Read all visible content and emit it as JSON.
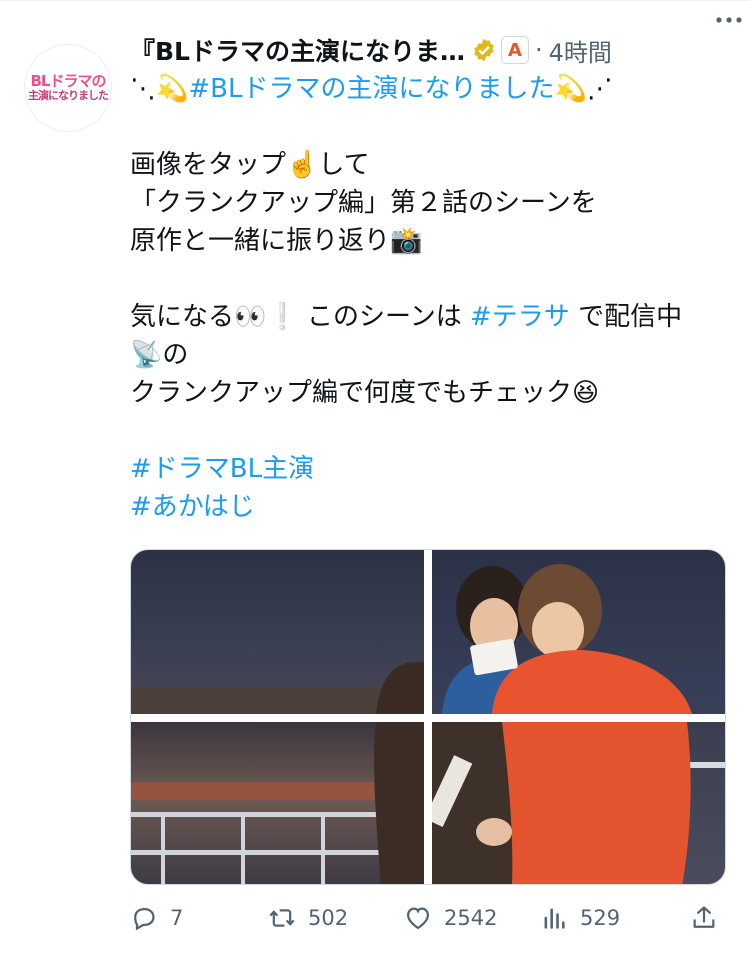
{
  "tweet": {
    "display_name": "『BLドラマの主演になりま…",
    "affiliate_badge": "A",
    "separator": "·",
    "timestamp": "4時間",
    "avatar_text_line1": "BLドラマの",
    "avatar_text_line2": "主演になりました",
    "lines": [
      {
        "pre": "⋱",
        "emoji1": "💫",
        "hashtag": "#BLドラマの主演になりました",
        "emoji2": "💫",
        "post": "⋰"
      },
      {
        "text": "画像をタップ",
        "emoji": "☝️",
        "after": "して"
      },
      {
        "text": "「クランクアップ編」第２話のシーンを"
      },
      {
        "text": "原作と一緒に振り返り",
        "emoji": "📸"
      },
      {
        "text": "気になる",
        "emoji1": "👀",
        "emoji2": "❕",
        "mid": "このシーンは",
        "hashtag": "#テラサ",
        "after": "で配信中"
      },
      {
        "emoji": "📡",
        "after": "の"
      },
      {
        "text": "クランクアップ編で何度でもチェック",
        "emoji": "😆"
      },
      {
        "hashtag": "#ドラマBL主演"
      },
      {
        "hashtag": "#あかはじ"
      }
    ]
  },
  "stats": {
    "replies": "7",
    "retweets": "502",
    "likes": "2542",
    "views": "529"
  },
  "icons": {
    "reply": "reply-icon",
    "retweet": "retweet-icon",
    "like": "heart-icon",
    "views": "views-icon",
    "share": "share-icon",
    "more": "more-icon",
    "verified": "verified-badge-icon"
  },
  "colors": {
    "hashtag": "#1d9bf0",
    "secondary_text": "#536471",
    "verified_gold": "#e2b719"
  }
}
